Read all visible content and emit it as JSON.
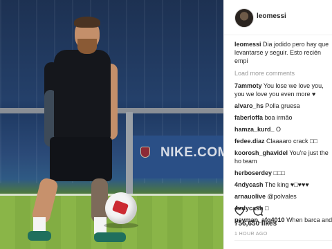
{
  "post": {
    "author": "leomessi",
    "photo_banner_text": "NIKE.COM/FC",
    "caption": {
      "user": "leomessi",
      "text": "Dia jodido pero hay que levantarse y seguir. Esto recién empi"
    },
    "load_more": "Load more comments",
    "comments": [
      {
        "user": "7ammoty",
        "text": "You lose we love you, you we love you even more ♥"
      },
      {
        "user": "alvaro_hs",
        "text": "Polla gruesa"
      },
      {
        "user": "faberloffa",
        "text": "boa irmão"
      },
      {
        "user": "hamza_kurd_",
        "text": "O"
      },
      {
        "user": "fedee.diaz",
        "text": "Claaaaro crack □□"
      },
      {
        "user": "koorosh_ghavidel",
        "text": "You're just the ho team"
      },
      {
        "user": "herboserdey",
        "text": "□□□"
      },
      {
        "user": "4ndycash",
        "text": "The king ♥□♥♥♥"
      },
      {
        "user": "arnauolive",
        "text": "@polvales"
      },
      {
        "user": "4ndycash",
        "text": "□"
      },
      {
        "user": "peyman_afg4010",
        "text": "When barca and b"
      }
    ],
    "likes": "756,650 likes",
    "time_ago": "1 HOUR AGO"
  },
  "icons": {
    "like": "heart-outline-icon",
    "comment": "speech-bubble-icon"
  },
  "colors": {
    "text": "#262626",
    "muted": "#999999",
    "border": "#efefef"
  }
}
